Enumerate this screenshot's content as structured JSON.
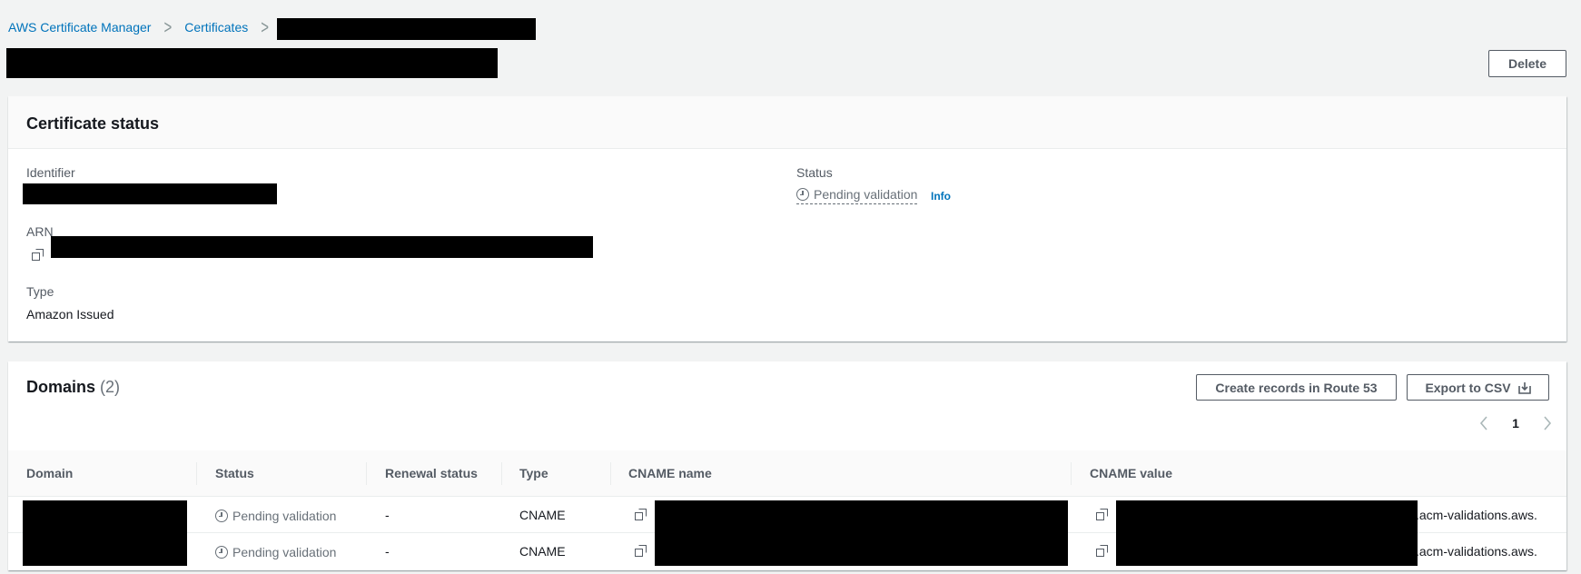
{
  "breadcrumb": {
    "items": [
      "AWS Certificate Manager",
      "Certificates"
    ],
    "separator": ">"
  },
  "header": {
    "delete_label": "Delete"
  },
  "cert_status": {
    "title": "Certificate status",
    "identifier_label": "Identifier",
    "arn_label": "ARN",
    "type_label": "Type",
    "type_value": "Amazon Issued",
    "status_label": "Status",
    "status_value": "Pending validation",
    "info_link": "Info"
  },
  "domains": {
    "title": "Domains",
    "count": "(2)",
    "create_records_label": "Create records in Route 53",
    "export_label": "Export to CSV",
    "page_number": "1",
    "columns": [
      "Domain",
      "Status",
      "Renewal status",
      "Type",
      "CNAME name",
      "CNAME value"
    ],
    "rows": [
      {
        "status": "Pending validation",
        "renewal": "-",
        "type": "CNAME",
        "cname_value_suffix": ".acm-validations.aws."
      },
      {
        "status": "Pending validation",
        "renewal": "-",
        "type": "CNAME",
        "cname_value_suffix": ".acm-validations.aws."
      }
    ]
  },
  "colors": {
    "link": "#0073bb",
    "background": "#f2f3f3",
    "redaction": "#000000"
  }
}
